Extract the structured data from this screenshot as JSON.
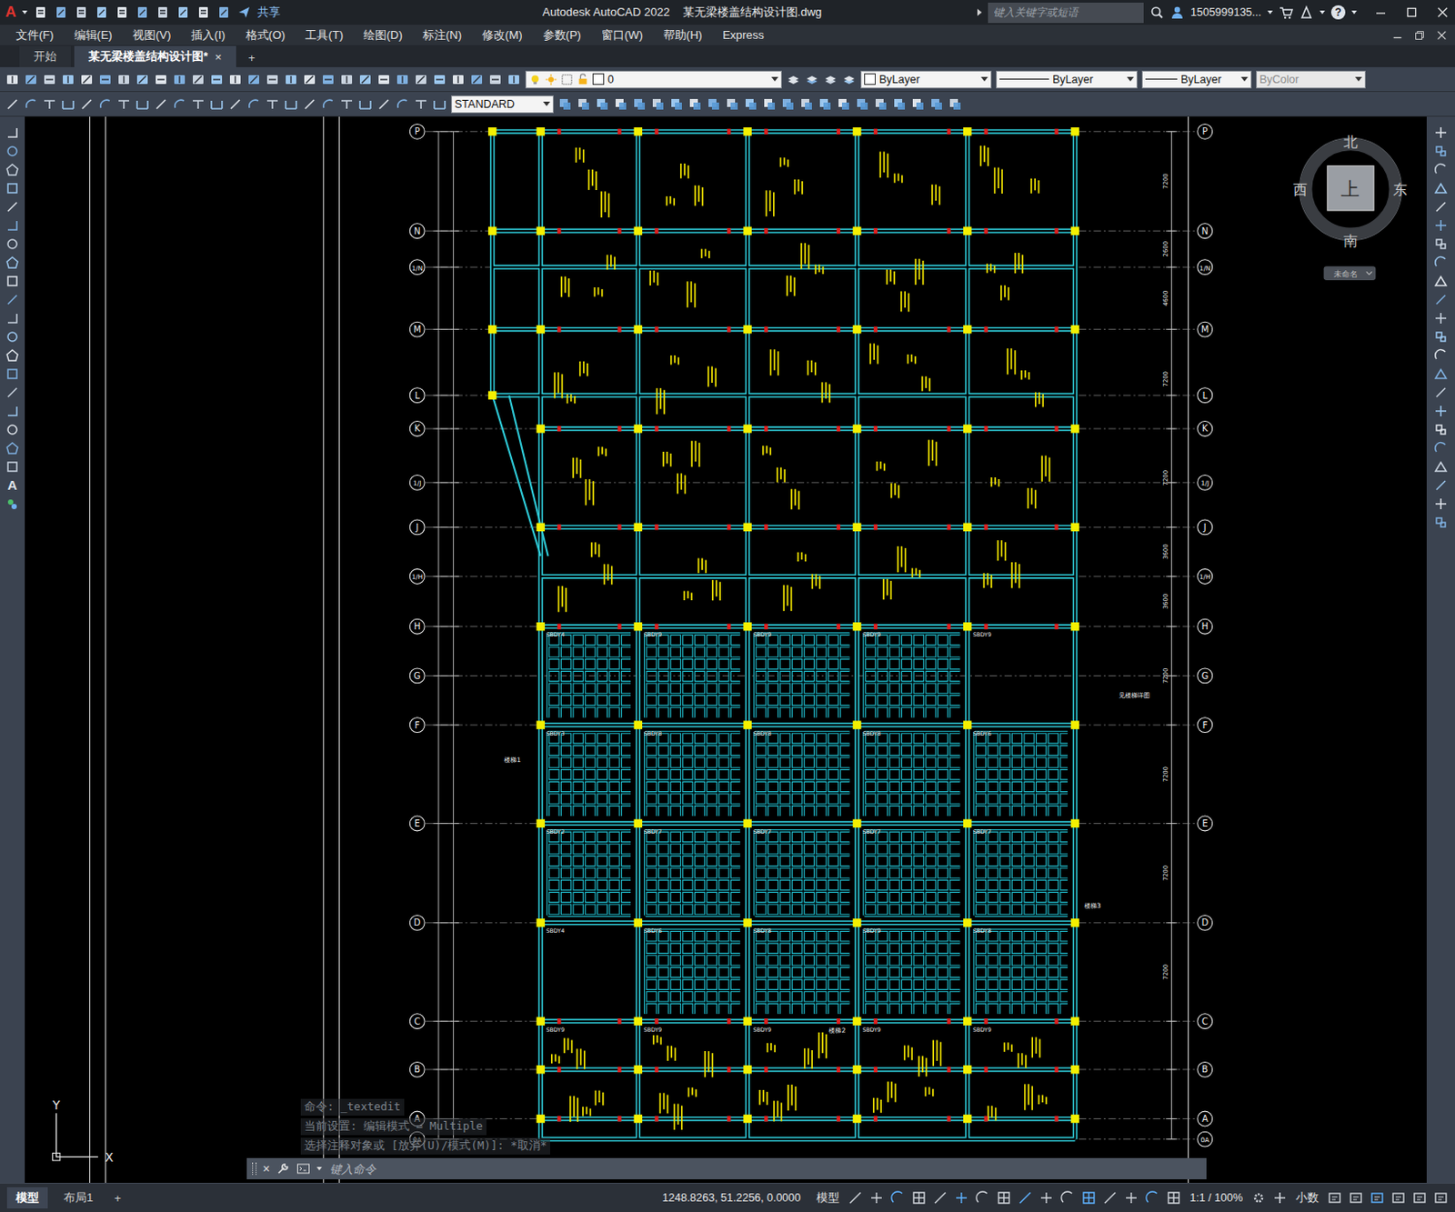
{
  "window": {
    "app_letter": "A",
    "share": "共享",
    "title": "Autodesk AutoCAD 2022    某无梁楼盖结构设计图.dwg",
    "search_placeholder": "键入关键字或短语",
    "user": "1505999135...",
    "help": "?"
  },
  "menu": [
    "文件(F)",
    "编辑(E)",
    "视图(V)",
    "插入(I)",
    "格式(O)",
    "工具(T)",
    "绘图(D)",
    "标注(N)",
    "修改(M)",
    "参数(P)",
    "窗口(W)",
    "帮助(H)",
    "Express"
  ],
  "tabs": [
    {
      "label": "开始",
      "selected": false,
      "closable": false
    },
    {
      "label": "某无梁楼盖结构设计图*",
      "selected": true,
      "closable": true
    }
  ],
  "tab_close": "×",
  "tab_add": "+",
  "properties": {
    "layer": "0",
    "color": "ByLayer",
    "linetype": "ByLayer",
    "lineweight": "ByLayer",
    "plot_style": "ByColor",
    "plot_style_disabled": true,
    "text_style": "STANDARD"
  },
  "left_toolbar_text": "A",
  "viewcube": {
    "north": "北",
    "south": "南",
    "west": "西",
    "east": "东",
    "face": "上",
    "ucs": "未命名"
  },
  "ucs_icon": {
    "x": "X",
    "y": "Y"
  },
  "drawing": {
    "axes": [
      "P",
      "N",
      "1/N",
      "M",
      "L",
      "K",
      "1/J",
      "J",
      "1/H",
      "H",
      "G",
      "F",
      "E",
      "D",
      "C",
      "B",
      "A",
      "0A"
    ],
    "slab_labels": [
      {
        "axis": "H",
        "labels": [
          "SBDY4",
          "SBDY9",
          "SBDY9",
          "SBDY9",
          "SBDY9"
        ]
      },
      {
        "axis": "F",
        "labels": [
          "SBDY3",
          "SBDY8",
          "SBDY8",
          "SBDY8",
          "SBDY6"
        ]
      },
      {
        "axis": "E",
        "labels": [
          "SBDY2",
          "SBDY7",
          "SBDY7",
          "SBDY7",
          "SBDY7"
        ]
      },
      {
        "axis": "D",
        "labels": [
          "SBDY4",
          "SBDY6",
          "SBDY8",
          "SBDY9",
          "SBDY8"
        ]
      },
      {
        "axis": "C",
        "labels": [
          "SBDY9",
          "SBDY9",
          "SBDY9",
          "SBDY9",
          "SBDY9"
        ]
      }
    ],
    "notes": [
      {
        "text": "见楼梯详图"
      },
      {
        "text": "楼梯1"
      },
      {
        "text": "楼梯3"
      },
      {
        "text": "楼梯2"
      }
    ],
    "dims": [
      {
        "text": "7200",
        "from": "P",
        "to": "N"
      },
      {
        "text": "2600",
        "from": "N",
        "to": "1/N"
      },
      {
        "text": "4600",
        "from": "1/N",
        "to": "M"
      },
      {
        "text": "7200",
        "from": "M",
        "to": "K"
      },
      {
        "text": "7200",
        "from": "K",
        "to": "J"
      },
      {
        "text": "3600",
        "from": "J",
        "to": "1/H"
      },
      {
        "text": "3600",
        "from": "1/H",
        "to": "H"
      },
      {
        "text": "7200",
        "from": "H",
        "to": "F"
      },
      {
        "text": "7200",
        "from": "F",
        "to": "E"
      },
      {
        "text": "7200",
        "from": "E",
        "to": "D"
      },
      {
        "text": "7200",
        "from": "D",
        "to": "C"
      }
    ]
  },
  "command": {
    "history": [
      "命令: _textedit",
      "当前设置: 编辑模式 = Multiple",
      "选择注释对象或 [放弃(U)/模式(M)]: *取消*"
    ],
    "placeholder": "键入命令",
    "close": "×"
  },
  "status": {
    "layouts": [
      {
        "label": "模型",
        "selected": true
      },
      {
        "label": "布局1",
        "selected": false
      }
    ],
    "add": "+",
    "coords": "1248.8263, 51.2256, 0.0000",
    "space": "模型",
    "scale": "1:1 / 100%",
    "units": "小数"
  }
}
